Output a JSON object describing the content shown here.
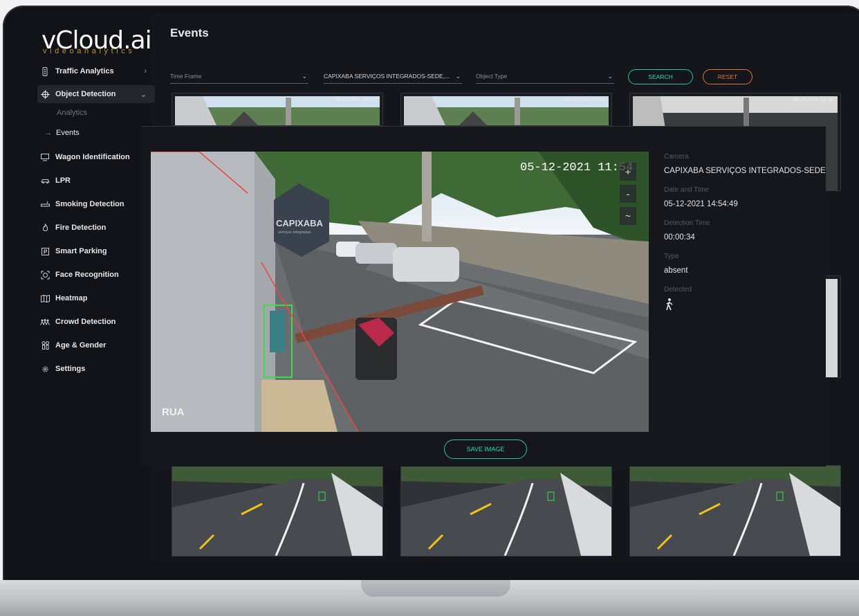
{
  "app": {
    "logo_text": "vCloud.ai",
    "logo_sub": "videoanalytics",
    "accent": "#2fd8b3",
    "reset_color": "#e0762d",
    "logo_sub_color": "#b99533"
  },
  "sidebar": {
    "items": [
      {
        "label": "Traffic Analytics",
        "icon": "traffic-light-icon"
      },
      {
        "label": "Object Detection",
        "icon": "crosshair-icon"
      },
      {
        "label": "Wagon Identification",
        "icon": "monitor-icon"
      },
      {
        "label": "LPR",
        "icon": "car-icon"
      },
      {
        "label": "Smoking Detection",
        "icon": "cigarette-icon"
      },
      {
        "label": "Fire Detection",
        "icon": "flame-icon"
      },
      {
        "label": "Smart Parking",
        "icon": "parking-icon"
      },
      {
        "label": "Face Recognition",
        "icon": "face-icon"
      },
      {
        "label": "Heatmap",
        "icon": "map-icon"
      },
      {
        "label": "Crowd Detection",
        "icon": "crowd-icon"
      },
      {
        "label": "Age & Gender",
        "icon": "people-icon"
      },
      {
        "label": "Settings",
        "icon": "gear-icon"
      }
    ],
    "sub": {
      "analytics": "Analytics",
      "events": "Events"
    }
  },
  "header": {
    "title": "Events"
  },
  "filters": {
    "time_frame": "Time Frame",
    "camera": "CAPIXABA SERVIÇOS INTEGRADOS-SEDE,...",
    "object_type": "Object Type",
    "search": "SEARCH",
    "reset": "RESET"
  },
  "thumbs": {
    "ts1": "05-12-2021 10:13",
    "ts2": "05-12-2021 11:54",
    "ts3": "05-12-2021 11:54"
  },
  "modal": {
    "timestamp": "05-12-2021  11:54",
    "street_label": "RUA",
    "sign_text": "CAPIXABA",
    "sign_sub": "serviços integrados",
    "zoom_in": "+",
    "zoom_out": "-",
    "zoom_reset": "~",
    "camera_label": "Camera",
    "camera_value": "CAPIXABA SERVIÇOS INTEGRADOS-SEDE",
    "datetime_label": "Date and Time",
    "datetime_value": "05-12-2021 14:54:49",
    "detection_label": "Detection Time",
    "detection_value": "00:00:34",
    "type_label": "Type",
    "type_value": "absent",
    "detected_label": "Detected",
    "detected_icon": "person-walking-icon",
    "save_button": "SAVE IMAGE"
  }
}
